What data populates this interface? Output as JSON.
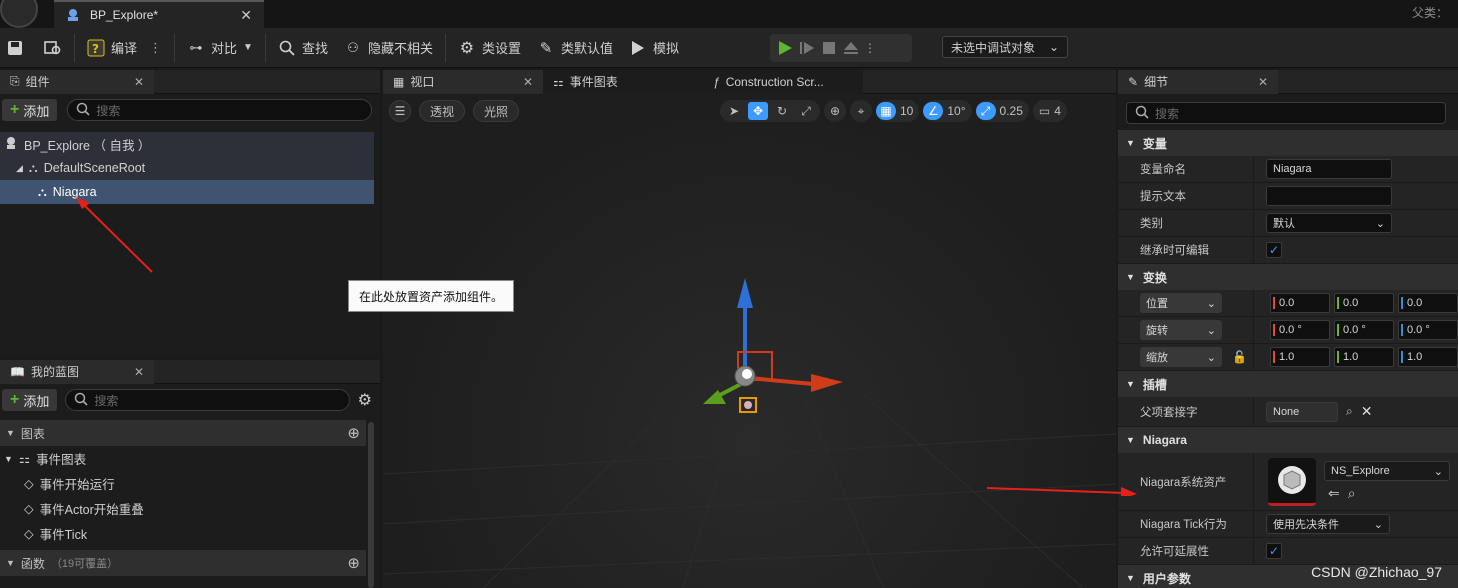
{
  "titlebar": {
    "tab_title": "BP_Explore*",
    "parent_label": "父类："
  },
  "toolbar": {
    "compile": "编译",
    "diff": "对比",
    "find": "查找",
    "hide_unrelated": "隐藏不相关",
    "class_settings": "类设置",
    "class_defaults": "类默认值",
    "simulate": "模拟",
    "debug_select": "未选中调试对象"
  },
  "components": {
    "tab": "组件",
    "add": "添加",
    "search_placeholder": "搜索",
    "items": [
      "BP_Explore （ 自我 ）",
      "DefaultSceneRoot",
      "Niagara"
    ]
  },
  "myblueprint": {
    "tab": "我的蓝图",
    "add": "添加",
    "search_placeholder": "搜索",
    "graphs_label": "图表",
    "event_graph": "事件图表",
    "events": [
      "事件开始运行",
      "事件Actor开始重叠",
      "事件Tick"
    ],
    "functions_label": "函数",
    "functions_count": "（19可覆盖）"
  },
  "viewport": {
    "tabs": [
      "视口",
      "事件图表",
      "Construction Scr..."
    ],
    "mode_perspective": "透视",
    "mode_lit": "光照",
    "grid_snap": "10",
    "rot_snap": "10°",
    "scale_snap": "0.25",
    "cam_speed": "4",
    "tooltip": "在此处放置资产添加组件。"
  },
  "details": {
    "tab": "细节",
    "search_placeholder": "搜索",
    "sec_variable": "变量",
    "var_name_label": "变量命名",
    "var_name": "Niagara",
    "tooltip_label": "提示文本",
    "tooltip_value": "",
    "category_label": "类别",
    "category": "默认",
    "inherit_label": "继承时可编辑",
    "sec_transform": "变换",
    "location": "位置",
    "rotation": "旋转",
    "scale": "缩放",
    "loc": [
      "0.0",
      "0.0",
      "0.0"
    ],
    "rot": [
      "0.0 °",
      "0.0 °",
      "0.0 °"
    ],
    "scl": [
      "1.0",
      "1.0",
      "1.0"
    ],
    "sec_socket": "插槽",
    "parent_socket_label": "父项套接字",
    "parent_socket": "None",
    "sec_niagara": "Niagara",
    "asset_label": "Niagara系统资产",
    "asset": "NS_Explore",
    "tick_label": "Niagara Tick行为",
    "tick": "使用先决条件",
    "scal_label": "允许可延展性",
    "sec_user": "用户参数"
  },
  "watermark": "CSDN @Zhichao_97",
  "colors": {
    "accent": "#3d9bff",
    "play": "#59b82c",
    "arrow": "#e8201a",
    "selected": "#3e5470"
  }
}
